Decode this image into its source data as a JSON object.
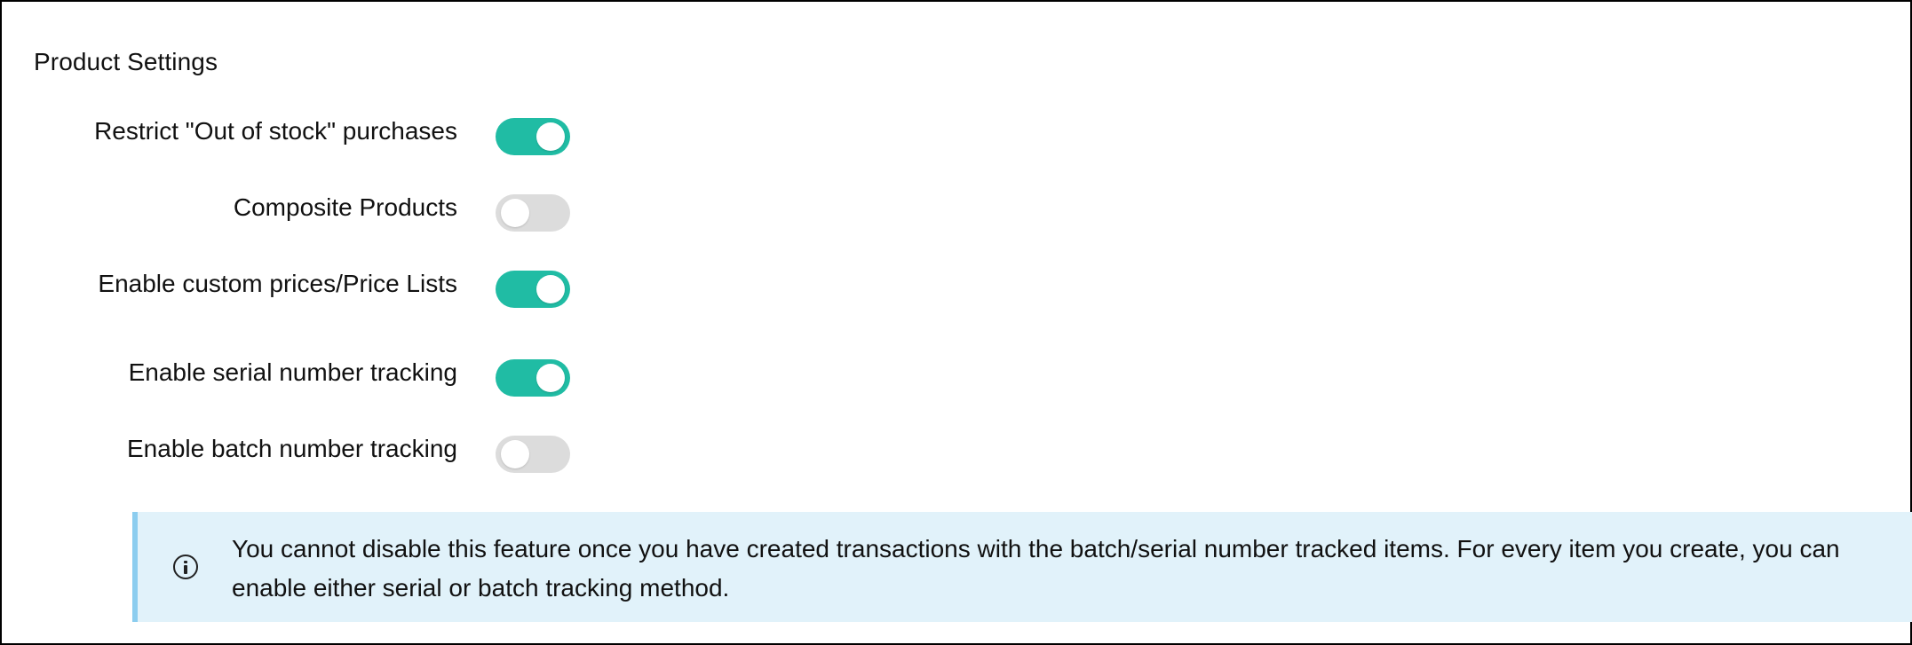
{
  "section": {
    "title": "Product Settings"
  },
  "settings": [
    {
      "label": "Restrict \"Out of stock\" purchases",
      "enabled": true
    },
    {
      "label": "Composite Products",
      "enabled": false
    },
    {
      "label": "Enable custom prices/Price Lists",
      "enabled": true
    },
    {
      "label": "Enable serial number tracking",
      "enabled": true
    },
    {
      "label": "Enable batch number tracking",
      "enabled": false
    }
  ],
  "info": {
    "icon": "info-icon",
    "text": "You cannot disable this feature once you have created transactions with the batch/serial number tracked items. For every item you create, you can enable either serial or batch tracking method."
  },
  "colors": {
    "toggle_on": "#20bca4",
    "toggle_off": "#dcdcdc",
    "info_background": "#e1f2fa",
    "info_border": "#8ccdef"
  }
}
